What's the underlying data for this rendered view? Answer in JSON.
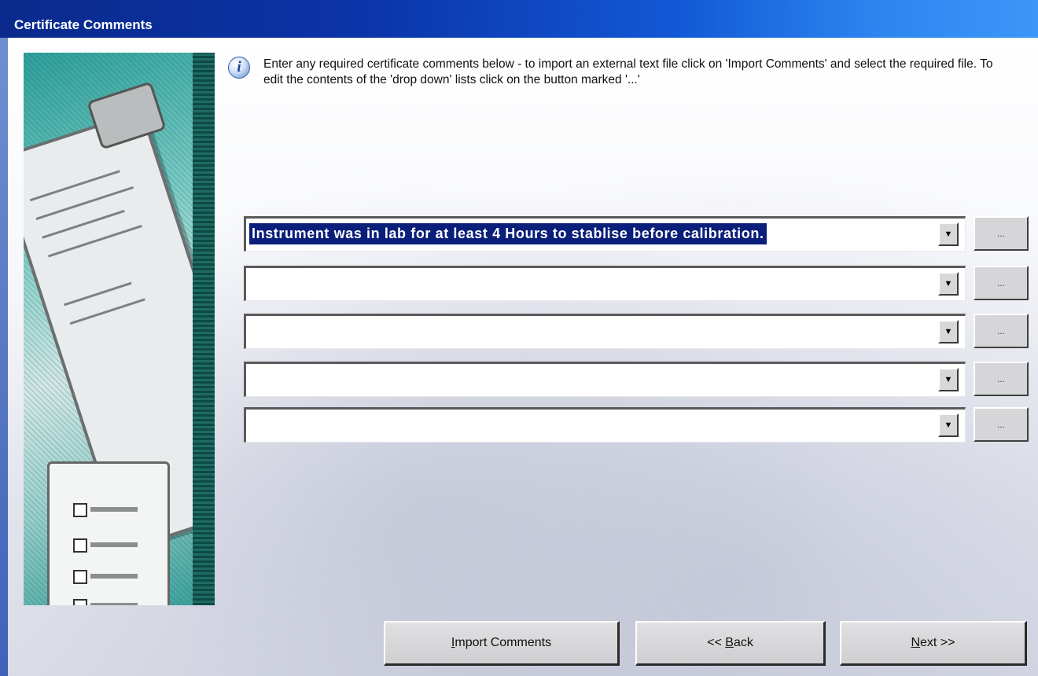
{
  "window": {
    "title": "Certificate Comments"
  },
  "info": {
    "icon": "info-icon",
    "icon_glyph": "i",
    "text": "Enter any required certificate comments below - to import an external text file click on 'Import Comments' and select the required file. To edit the contents of the 'drop down' lists click on the button marked '...'"
  },
  "comments": [
    {
      "value": "Instrument was in lab for at least 4 Hours to stablise before calibration.",
      "selected": true
    },
    {
      "value": "",
      "selected": false
    },
    {
      "value": "",
      "selected": false
    },
    {
      "value": "",
      "selected": false
    },
    {
      "value": "",
      "selected": false
    }
  ],
  "combo": {
    "dropdown_glyph": "▼",
    "edit_button_label": "..."
  },
  "buttons": {
    "import": {
      "mnemonic": "I",
      "rest": "mport Comments"
    },
    "back": {
      "prefix": "<< ",
      "mnemonic": "B",
      "rest": "ack"
    },
    "next": {
      "mnemonic": "N",
      "rest": "ext >>"
    }
  },
  "colors": {
    "title_gradient_start": "#0a2a8c",
    "title_gradient_end": "#3c97f8",
    "selection": "#0a1f7a"
  }
}
